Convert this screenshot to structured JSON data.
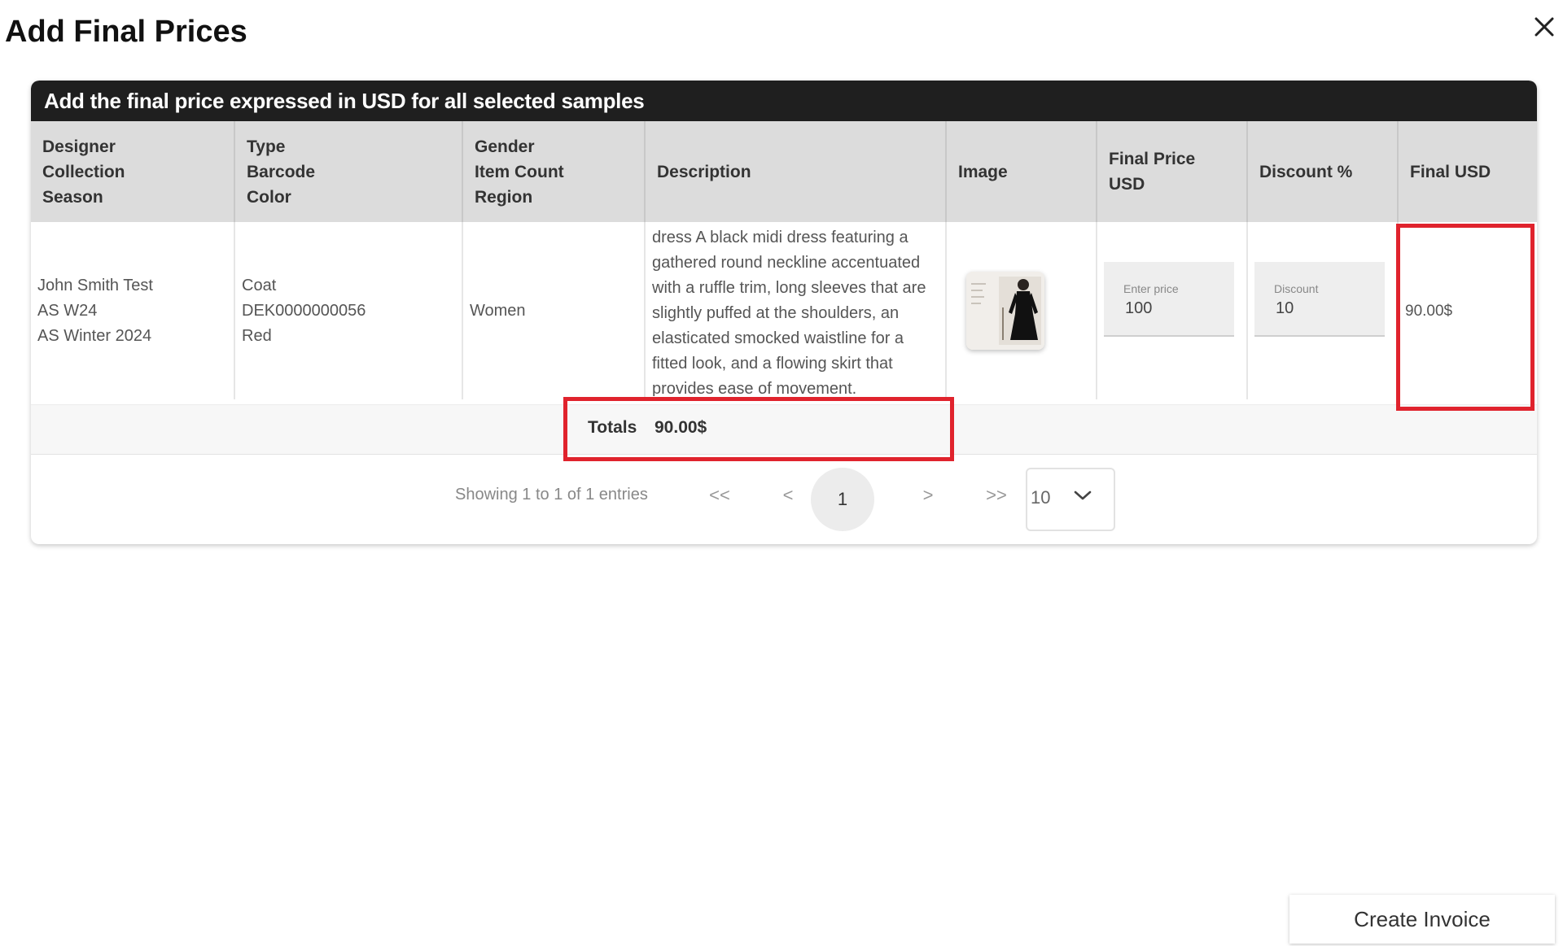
{
  "dialog": {
    "title": "Add Final Prices",
    "close_icon": "close-icon"
  },
  "card": {
    "header": "Add the final price expressed in USD for all selected samples"
  },
  "table": {
    "headers": [
      {
        "lines": [
          "Designer",
          "Collection",
          "Season"
        ]
      },
      {
        "lines": [
          "Type",
          "Barcode",
          "Color"
        ]
      },
      {
        "lines": [
          "Gender",
          "Item Count",
          "Region"
        ]
      },
      {
        "lines": [
          "Description"
        ]
      },
      {
        "lines": [
          "Image"
        ]
      },
      {
        "lines": [
          "Final Price USD"
        ]
      },
      {
        "lines": [
          "Discount %"
        ]
      },
      {
        "lines": [
          "Final USD"
        ]
      }
    ],
    "rows": [
      {
        "designer": "John Smith Test",
        "collection": "AS W24",
        "season": "AS Winter 2024",
        "type": "Coat",
        "barcode": "DEK0000000056",
        "color": "Red",
        "gender": "Women",
        "description": "dress A black midi dress featuring a gathered round neckline accentuated with a ruffle trim, long sleeves that are slightly puffed at the shoulders, an elasticated smocked waistline for a fitted look, and a flowing skirt that provides ease of movement.",
        "image_icon": "dress-thumbnail",
        "final_price": {
          "label": "Enter price",
          "value": "100"
        },
        "discount": {
          "label": "Discount",
          "value": "10"
        },
        "final_usd": "90.00$"
      }
    ]
  },
  "totals": {
    "label": "Totals",
    "value": "90.00$"
  },
  "pagination": {
    "info": "Showing 1 to 1 of 1 entries",
    "first": "<<",
    "prev": "<",
    "current": "1",
    "next": ">",
    "last": ">>",
    "page_size": "10"
  },
  "actions": {
    "create_invoice": "Create Invoice"
  },
  "colors": {
    "header_bg": "#1f1f1f",
    "column_header_bg": "#dcdcdc",
    "highlight": "#e0232d"
  }
}
